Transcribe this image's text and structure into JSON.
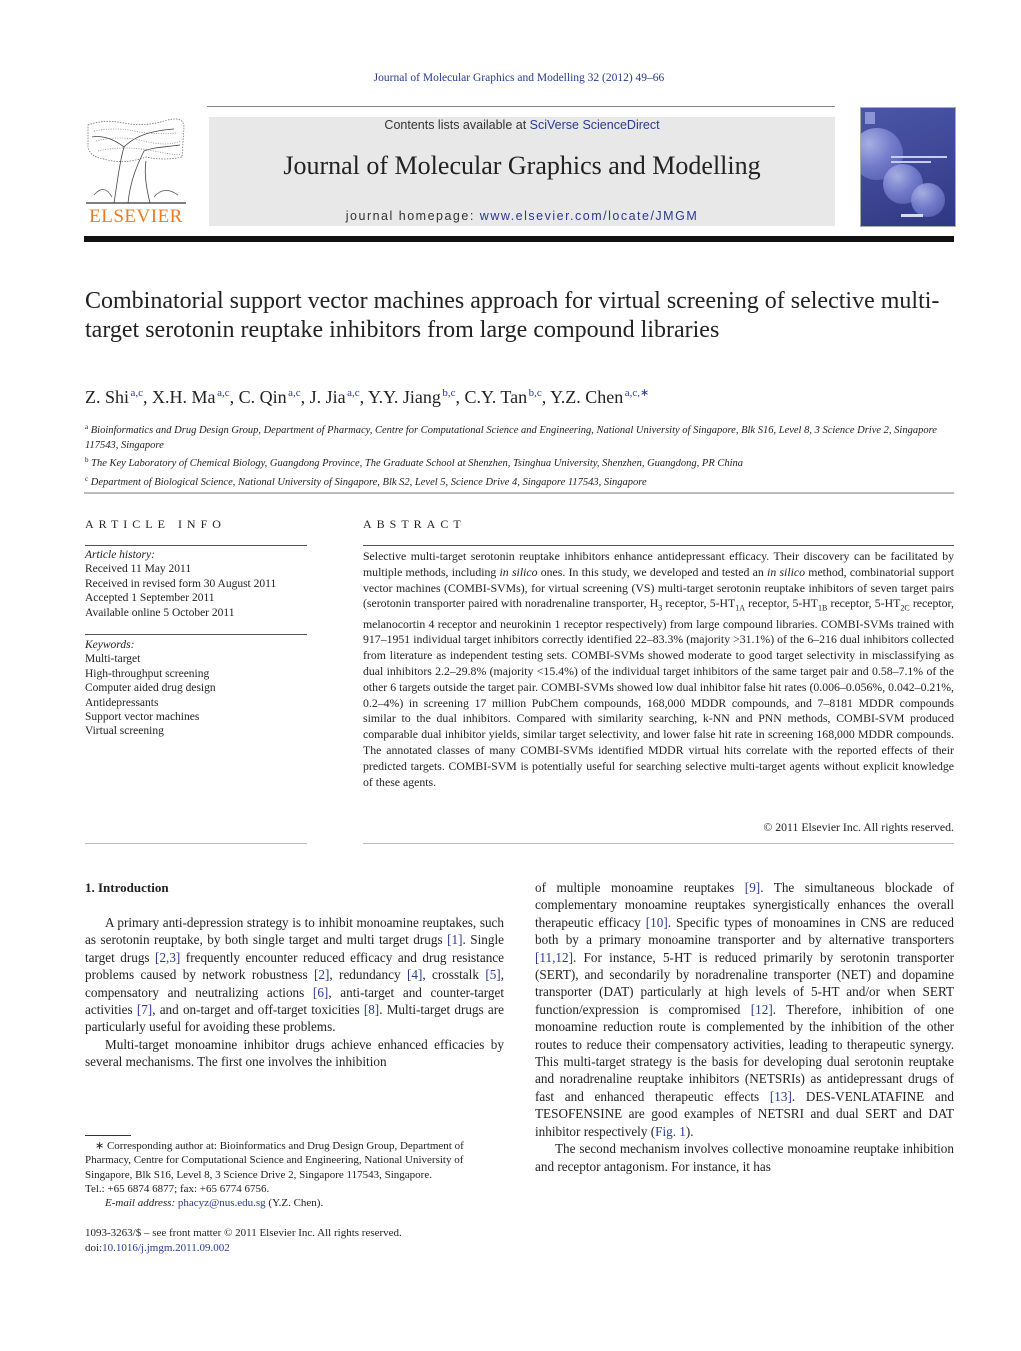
{
  "header": {
    "citation": "Journal of Molecular Graphics and Modelling 32 (2012) 49–66",
    "contents_prefix": "Contents lists available at ",
    "contents_link": "SciVerse ScienceDirect",
    "journal_name": "Journal of Molecular Graphics and Modelling",
    "homepage_prefix": "journal homepage: ",
    "homepage_link": "www.elsevier.com/locate/JMGM",
    "publisher_logo": "ELSEVIER",
    "colors": {
      "link": "#2a3a8f",
      "logo": "#f07a1e",
      "masthead_bg": "#e8e8e8",
      "cover": "#3c4593"
    }
  },
  "article": {
    "title": "Combinatorial support vector machines approach for virtual screening of selective multi-target serotonin reuptake inhibitors from large compound libraries",
    "authors": [
      {
        "name": "Z. Shi",
        "aff": "a,c"
      },
      {
        "name": "X.H. Ma",
        "aff": "a,c"
      },
      {
        "name": "C. Qin",
        "aff": "a,c"
      },
      {
        "name": "J. Jia",
        "aff": "a,c"
      },
      {
        "name": "Y.Y. Jiang",
        "aff": "b,c"
      },
      {
        "name": "C.Y. Tan",
        "aff": "b,c"
      },
      {
        "name": "Y.Z. Chen",
        "aff": "a,c,∗"
      }
    ],
    "affiliations": [
      {
        "key": "a",
        "text": "Bioinformatics and Drug Design Group, Department of Pharmacy, Centre for Computational Science and Engineering, National University of Singapore, Blk S16, Level 8, 3 Science Drive 2, Singapore 117543, Singapore"
      },
      {
        "key": "b",
        "text": "The Key Laboratory of Chemical Biology, Guangdong Province, The Graduate School at Shenzhen, Tsinghua University, Shenzhen, Guangdong, PR China"
      },
      {
        "key": "c",
        "text": "Department of Biological Science, National University of Singapore, Blk S2, Level 5, Science Drive 4, Singapore 117543, Singapore"
      }
    ]
  },
  "article_info": {
    "heading": "ARTICLE INFO",
    "history_label": "Article history:",
    "history": [
      "Received 11 May 2011",
      "Received in revised form 30 August 2011",
      "Accepted 1 September 2011",
      "Available online 5 October 2011"
    ],
    "keywords_label": "Keywords:",
    "keywords": [
      "Multi-target",
      "High-throughput screening",
      "Computer aided drug design",
      "Antidepressants",
      "Support vector machines",
      "Virtual screening"
    ]
  },
  "abstract": {
    "heading": "ABSTRACT",
    "p1": "Selective multi-target serotonin reuptake inhibitors enhance antidepressant efficacy. Their discovery can be facilitated by multiple methods, including ",
    "p1_it": "in silico",
    "p2": " ones. In this study, we developed and tested an ",
    "p2_it": "in silico",
    "p3": " method, combinatorial support vector machines (COMBI-SVMs), for virtual screening (VS) multi-target serotonin reuptake inhibitors of seven target pairs (serotonin transporter paired with noradrenaline transporter, H",
    "sub_h3": "3",
    "p4": " receptor, 5-HT",
    "sub_1a": "1A",
    "p5": " receptor, 5-HT",
    "sub_1b": "1B",
    "p6": " receptor, 5-HT",
    "sub_2c": "2C",
    "p7": " receptor, melanocortin 4 receptor and neurokinin 1 receptor respectively) from large compound libraries. COMBI-SVMs trained with 917–1951 individual target inhibitors correctly identified 22–83.3% (majority >31.1%) of the 6–216 dual inhibitors collected from literature as independent testing sets. COMBI-SVMs showed moderate to good target selectivity in misclassifying as dual inhibitors 2.2–29.8% (majority <15.4%) of the individual target inhibitors of the same target pair and 0.58–7.1% of the other 6 targets outside the target pair. COMBI-SVMs showed low dual inhibitor false hit rates (0.006–0.056%, 0.042–0.21%, 0.2–4%) in screening 17 million PubChem compounds, 168,000 MDDR compounds, and 7–8181 MDDR compounds similar to the dual inhibitors. Compared with similarity searching, k-NN and PNN methods, COMBI-SVM produced comparable dual inhibitor yields, similar target selectivity, and lower false hit rate in screening 168,000 MDDR compounds. The annotated classes of many COMBI-SVMs identified MDDR virtual hits correlate with the reported effects of their predicted targets. COMBI-SVM is potentially useful for searching selective multi-target agents without explicit knowledge of these agents.",
    "copyright": "© 2011 Elsevier Inc. All rights reserved."
  },
  "introduction": {
    "heading": "1.  Introduction",
    "left": [
      {
        "type": "p",
        "segments": [
          {
            "t": "A primary anti-depression strategy is to inhibit monoamine reuptakes, such as serotonin reuptake, by both single target and multi target drugs "
          },
          {
            "t": "[1]",
            "ref": true
          },
          {
            "t": ". Single target drugs "
          },
          {
            "t": "[2,3]",
            "ref": true
          },
          {
            "t": " frequently encounter reduced efficacy and drug resistance problems caused by network robustness "
          },
          {
            "t": "[2]",
            "ref": true
          },
          {
            "t": ", redundancy "
          },
          {
            "t": "[4]",
            "ref": true
          },
          {
            "t": ", crosstalk "
          },
          {
            "t": "[5]",
            "ref": true
          },
          {
            "t": ", compensatory and neutralizing actions "
          },
          {
            "t": "[6]",
            "ref": true
          },
          {
            "t": ", anti-target and counter-target activities "
          },
          {
            "t": "[7]",
            "ref": true
          },
          {
            "t": ", and on-target and off-target toxicities "
          },
          {
            "t": "[8]",
            "ref": true
          },
          {
            "t": ". Multi-target drugs are particularly useful for avoiding these problems."
          }
        ]
      },
      {
        "type": "p",
        "segments": [
          {
            "t": "Multi-target monoamine inhibitor drugs achieve enhanced efficacies by several mechanisms. The first one involves the inhibition"
          }
        ]
      }
    ],
    "right": [
      {
        "type": "cont",
        "segments": [
          {
            "t": "of multiple monoamine reuptakes "
          },
          {
            "t": "[9]",
            "ref": true
          },
          {
            "t": ". The simultaneous blockade of complementary monoamine reuptakes synergistically enhances the overall therapeutic efficacy "
          },
          {
            "t": "[10]",
            "ref": true
          },
          {
            "t": ". Specific types of monoamines in CNS are reduced both by a primary monoamine transporter and by alternative transporters "
          },
          {
            "t": "[11,12]",
            "ref": true
          },
          {
            "t": ". For instance, 5-HT is reduced primarily by serotonin transporter (SERT), and secondarily by noradrenaline transporter (NET) and dopamine transporter (DAT) particularly at high levels of 5-HT and/or when SERT function/expression is compromised "
          },
          {
            "t": "[12]",
            "ref": true
          },
          {
            "t": ". Therefore, inhibition of one monoamine reduction route is complemented by the inhibition of the other routes to reduce their compensatory activities, leading to therapeutic synergy. This multi-target strategy is the basis for developing dual serotonin reuptake and noradrenaline reuptake inhibitors (NETSRIs) as antidepressant drugs of fast and enhanced therapeutic effects "
          },
          {
            "t": "[13]",
            "ref": true
          },
          {
            "t": ". DES-VENLATAFINE and TESOFENSINE are good examples of NETSRI and dual SERT and DAT inhibitor respectively ("
          },
          {
            "t": "Fig. 1",
            "ref": true
          },
          {
            "t": ")."
          }
        ]
      },
      {
        "type": "p",
        "segments": [
          {
            "t": "The second mechanism involves collective monoamine reuptake inhibition and receptor antagonism. For instance, it has"
          }
        ]
      }
    ]
  },
  "footnote": {
    "corresponding": "∗ Corresponding author at: Bioinformatics and Drug Design Group, Department of Pharmacy, Centre for Computational Science and Engineering, National University of Singapore, Blk S16, Level 8, 3 Science Drive 2, Singapore 117543, Singapore.",
    "tel": "Tel.: +65 6874 6877; fax: +65 6774 6756.",
    "email_label": "E-mail address:",
    "email": "phacyz@nus.edu.sg",
    "email_owner": " (Y.Z. Chen)."
  },
  "front_matter": {
    "issn_line": "1093-3263/$ – see front matter © 2011 Elsevier Inc. All rights reserved.",
    "doi_prefix": "doi:",
    "doi": "10.1016/j.jmgm.2011.09.002"
  }
}
